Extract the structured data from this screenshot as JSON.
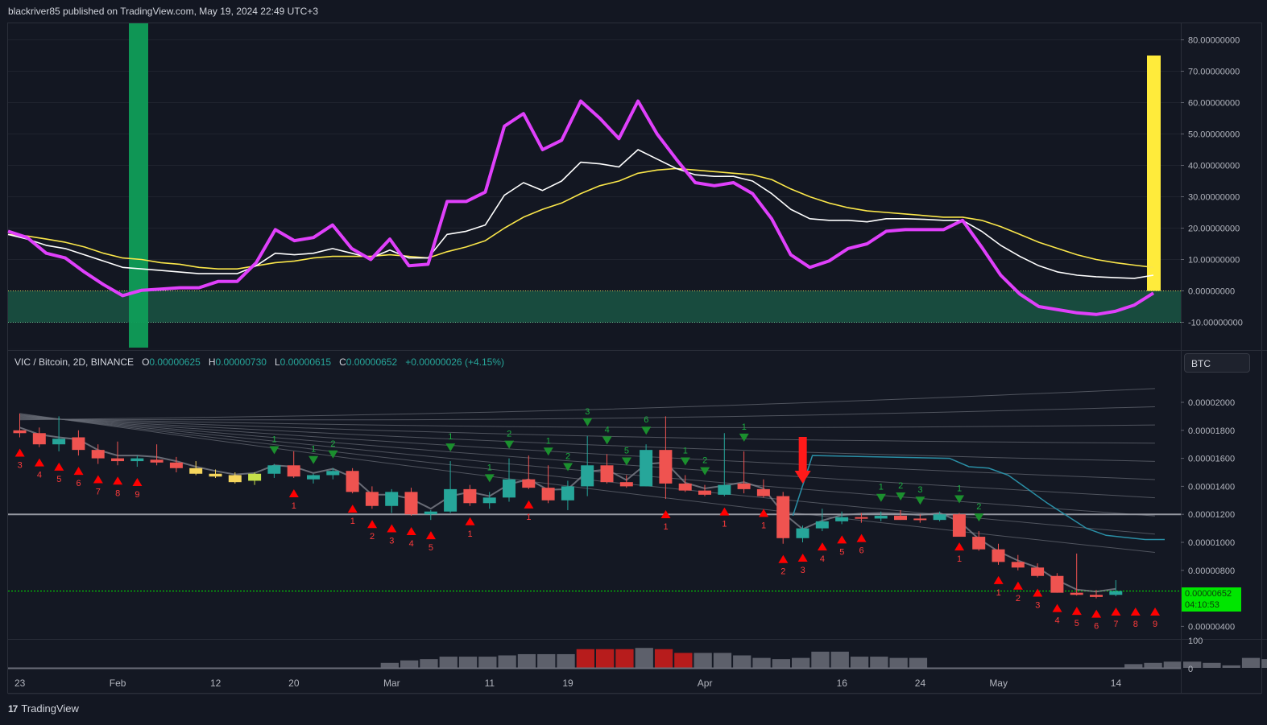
{
  "header": {
    "published": "blackriver85 published on TradingView.com, May 19, 2024 22:49 UTC+3"
  },
  "footer": {
    "brand": "TradingView",
    "brand_icon": "tradingview-logo-icon"
  },
  "colors": {
    "background": "#131722",
    "oscillator": "#e040fb",
    "signal_white": "#ffffff",
    "signal_yellow": "#fbe74a",
    "zone_green": "#1b5e48",
    "up": "#26a69a",
    "down": "#ef5350",
    "buy_marker": "#0f9d2c",
    "sell_marker": "#ff0000"
  },
  "legend": {
    "symbol": "VIC / Bitcoin, 2D, BINANCE",
    "o_label": "O",
    "o": "0.00000625",
    "h_label": "H",
    "h": "0.00000730",
    "l_label": "L",
    "l": "0.00000615",
    "c_label": "C",
    "c": "0.00000652",
    "change": "+0.00000026 (+4.15%)"
  },
  "scale_button": "BTC",
  "last_price": {
    "value": "0.00000652",
    "countdown": "04:10:53"
  },
  "chart_data": [
    {
      "type": "line",
      "name": "oscillator-pane",
      "ylim": [
        -10,
        85
      ],
      "y_ticks": [
        "80.00000000",
        "70.00000000",
        "60.00000000",
        "50.00000000",
        "40.00000000",
        "30.00000000",
        "20.00000000",
        "10.00000000",
        "0.00000000",
        "-10.00000000"
      ],
      "y_tick_values": [
        80,
        70,
        60,
        50,
        40,
        30,
        20,
        10,
        0,
        -10
      ],
      "zone": [
        -10,
        0
      ],
      "series": [
        {
          "color": "#e040fb",
          "values": [
            19,
            17,
            12,
            10.5,
            6,
            2,
            -1.5,
            0.2,
            0.6,
            1,
            1,
            3,
            3,
            9,
            19.5,
            16,
            17,
            21,
            13.5,
            10,
            16.5,
            8,
            8.5,
            28.5,
            28.5,
            31.5,
            52.5,
            56.5,
            45,
            48,
            60.5,
            55,
            48.5,
            60.5,
            50,
            42,
            34.5,
            33.5,
            34.5,
            31,
            23,
            11.5,
            7.5,
            9.5,
            13.5,
            15,
            19,
            19.5,
            19.5,
            19.5,
            22.5,
            14,
            5,
            -1,
            -5,
            -6,
            -7,
            -7.5,
            -6.5,
            -4.5,
            -0.7
          ]
        },
        {
          "color": "#ffffff",
          "values": [
            18,
            16.5,
            14.5,
            13.5,
            11.5,
            9.5,
            7.5,
            7,
            6.5,
            6,
            5.5,
            5.5,
            5.5,
            8,
            12,
            11.5,
            12,
            13.5,
            12,
            10.5,
            13,
            10.5,
            10.5,
            18,
            19,
            21,
            30.5,
            34.5,
            32,
            35,
            41,
            40.5,
            39.5,
            45,
            42,
            39,
            37,
            36.5,
            36.5,
            35,
            31,
            26,
            23,
            22.5,
            22.5,
            22,
            23,
            23,
            22.8,
            22.5,
            22.5,
            19,
            14.5,
            11,
            8,
            6,
            5,
            4.5,
            4.2,
            4,
            5
          ]
        },
        {
          "color": "#fbe74a",
          "values": [
            18,
            17.5,
            16.5,
            15.5,
            14,
            12,
            10.5,
            10,
            9,
            8.5,
            7.5,
            7,
            7,
            8,
            9,
            9.5,
            10.5,
            11,
            11,
            11,
            11.5,
            11,
            10.5,
            12.5,
            14,
            16,
            20,
            23.5,
            26,
            28,
            31,
            33.5,
            35,
            37.5,
            38.5,
            39,
            38.5,
            38,
            37.5,
            37,
            35.5,
            32.5,
            30,
            28,
            26.5,
            25.5,
            25,
            24.5,
            24,
            23.5,
            23.5,
            22.5,
            20.5,
            18,
            15.5,
            13.5,
            11.5,
            10,
            9,
            8.2,
            7.5
          ]
        }
      ],
      "signal_bars": [
        {
          "color": "#0f9d58",
          "x_index": 6.5,
          "height": "full"
        },
        {
          "color": "#ffeb3b",
          "x_index": 59.5,
          "top": 75
        }
      ]
    },
    {
      "type": "candlestick",
      "name": "price-pane",
      "ylim": [
        3.4e-06,
        2.16e-05
      ],
      "y_ticks": [
        "0.00002000",
        "0.00001800",
        "0.00001600",
        "0.00001400",
        "0.00001200",
        "0.00001000",
        "0.00000800",
        "0.00000400"
      ],
      "y_tick_values": [
        2e-05,
        1.8e-05,
        1.6e-05,
        1.4e-05,
        1.2e-05,
        1e-05,
        8e-06,
        4e-06
      ],
      "x_ticks": [
        {
          "label": "23",
          "i": 0.5
        },
        {
          "label": "Feb",
          "i": 5.5
        },
        {
          "label": "12",
          "i": 10.5
        },
        {
          "label": "20",
          "i": 14.5
        },
        {
          "label": "Mar",
          "i": 19.5
        },
        {
          "label": "11",
          "i": 24.5
        },
        {
          "label": "19",
          "i": 28.5
        },
        {
          "label": "Apr",
          "i": 35.5
        },
        {
          "label": "16",
          "i": 42.5
        },
        {
          "label": "24",
          "i": 46.5
        },
        {
          "label": "May",
          "i": 50.5
        },
        {
          "label": "14",
          "i": 56.5
        }
      ],
      "ohlc": [
        [
          18.0,
          19.2,
          17.5,
          17.8
        ],
        [
          17.8,
          18.2,
          16.8,
          17.0
        ],
        [
          17.0,
          19.0,
          16.5,
          17.4
        ],
        [
          17.5,
          18.0,
          16.2,
          16.6
        ],
        [
          16.6,
          17.0,
          15.6,
          16.0
        ],
        [
          16.0,
          17.2,
          15.5,
          15.8
        ],
        [
          15.8,
          16.2,
          15.4,
          16.0
        ],
        [
          15.9,
          17.0,
          15.5,
          15.7
        ],
        [
          15.7,
          16.1,
          15.0,
          15.3
        ],
        [
          15.3,
          15.8,
          14.8,
          14.9
        ],
        [
          14.9,
          15.2,
          14.6,
          14.7
        ],
        [
          14.8,
          15.0,
          14.2,
          14.3
        ],
        [
          14.4,
          15.0,
          14.1,
          14.9
        ],
        [
          14.9,
          15.6,
          14.6,
          15.5
        ],
        [
          15.5,
          16.5,
          14.6,
          14.7
        ],
        [
          14.5,
          14.9,
          14.2,
          14.8
        ],
        [
          14.8,
          15.3,
          14.5,
          15.1
        ],
        [
          15.1,
          15.3,
          13.5,
          13.6
        ],
        [
          13.6,
          14.0,
          12.4,
          12.6
        ],
        [
          12.6,
          13.8,
          12.1,
          13.6
        ],
        [
          13.6,
          13.9,
          11.9,
          12.0
        ],
        [
          12.0,
          12.3,
          11.6,
          12.2
        ],
        [
          12.2,
          15.8,
          12.1,
          13.8
        ],
        [
          13.8,
          14.1,
          12.6,
          12.8
        ],
        [
          12.8,
          13.6,
          12.4,
          13.2
        ],
        [
          13.2,
          16.0,
          12.9,
          14.5
        ],
        [
          14.5,
          16.2,
          13.8,
          13.9
        ],
        [
          13.9,
          15.5,
          12.8,
          13.0
        ],
        [
          13.0,
          14.4,
          12.3,
          14.0
        ],
        [
          14.0,
          17.6,
          13.3,
          15.5
        ],
        [
          15.5,
          16.3,
          14.2,
          14.3
        ],
        [
          14.3,
          14.8,
          13.9,
          14.0
        ],
        [
          14.0,
          17.0,
          14.0,
          16.6
        ],
        [
          16.6,
          19.0,
          13.1,
          14.2
        ],
        [
          14.2,
          14.8,
          13.6,
          13.7
        ],
        [
          13.7,
          14.1,
          13.3,
          13.4
        ],
        [
          13.4,
          17.8,
          13.3,
          14.1
        ],
        [
          14.2,
          16.5,
          13.5,
          13.8
        ],
        [
          13.8,
          14.5,
          13.2,
          13.3
        ],
        [
          13.3,
          13.6,
          9.9,
          10.3
        ],
        [
          10.3,
          11.2,
          10.0,
          11.0
        ],
        [
          11.0,
          12.4,
          10.8,
          11.5
        ],
        [
          11.5,
          12.2,
          11.3,
          11.8
        ],
        [
          11.8,
          12.1,
          11.4,
          11.7
        ],
        [
          11.7,
          12.2,
          11.5,
          11.9
        ],
        [
          11.9,
          12.3,
          11.6,
          11.6
        ],
        [
          11.7,
          12.0,
          11.4,
          11.6
        ],
        [
          11.6,
          12.2,
          11.5,
          12.0
        ],
        [
          12.0,
          12.1,
          10.8,
          10.4
        ],
        [
          10.4,
          10.8,
          9.4,
          9.5
        ],
        [
          9.5,
          9.9,
          8.4,
          8.6
        ],
        [
          8.6,
          9.1,
          8.0,
          8.2
        ],
        [
          8.2,
          8.5,
          7.5,
          7.6
        ],
        [
          7.6,
          7.8,
          6.4,
          6.4
        ],
        [
          6.4,
          9.2,
          6.2,
          6.25
        ],
        [
          6.25,
          6.6,
          6.0,
          6.1
        ],
        [
          6.25,
          7.3,
          6.15,
          6.52
        ]
      ],
      "ohlc_unit": "0.000001",
      "volume_ticks": [
        "100",
        "0"
      ],
      "volume": [
        0,
        0,
        0,
        0,
        0,
        0,
        0,
        0,
        0,
        0,
        0,
        0,
        0,
        0,
        0,
        0,
        0,
        0,
        0,
        20,
        30,
        35,
        45,
        45,
        45,
        50,
        55,
        55,
        55,
        75,
        75,
        75,
        80,
        75,
        60,
        60,
        60,
        50,
        40,
        35,
        40,
        65,
        65,
        45,
        45,
        40,
        40,
        0,
        0,
        0,
        0,
        0,
        0,
        0,
        0,
        0,
        0,
        15,
        20,
        25,
        25,
        20,
        10,
        40,
        35,
        45
      ],
      "volume_red": [
        29,
        30,
        31,
        33,
        34
      ],
      "sequential_sell": [
        {
          "i": 0.5,
          "n": "3"
        },
        {
          "i": 1.5,
          "n": "4"
        },
        {
          "i": 2.5,
          "n": "5"
        },
        {
          "i": 3.5,
          "n": "6"
        },
        {
          "i": 4.5,
          "n": "7"
        },
        {
          "i": 5.5,
          "n": "8"
        },
        {
          "i": 6.5,
          "n": "9"
        },
        {
          "i": 14.5,
          "n": "1"
        },
        {
          "i": 17.5,
          "n": "1"
        },
        {
          "i": 18.5,
          "n": "2"
        },
        {
          "i": 19.5,
          "n": "3"
        },
        {
          "i": 20.5,
          "n": "4"
        },
        {
          "i": 21.5,
          "n": "5"
        },
        {
          "i": 23.5,
          "n": "1"
        },
        {
          "i": 26.5,
          "n": "1"
        },
        {
          "i": 33.5,
          "n": "1"
        },
        {
          "i": 36.5,
          "n": "1"
        },
        {
          "i": 38.5,
          "n": "1"
        },
        {
          "i": 39.5,
          "n": "2"
        },
        {
          "i": 40.5,
          "n": "3"
        },
        {
          "i": 41.5,
          "n": "4"
        },
        {
          "i": 42.5,
          "n": "5"
        },
        {
          "i": 43.5,
          "n": "6"
        },
        {
          "i": 48.5,
          "n": "1"
        },
        {
          "i": 50.5,
          "n": "1"
        },
        {
          "i": 51.5,
          "n": "2"
        },
        {
          "i": 52.5,
          "n": "3"
        },
        {
          "i": 53.5,
          "n": "4"
        },
        {
          "i": 54.5,
          "n": "5"
        },
        {
          "i": 55.5,
          "n": "6"
        },
        {
          "i": 56.5,
          "n": "7"
        },
        {
          "i": 57.5,
          "n": "8"
        },
        {
          "i": 58.5,
          "n": "9"
        }
      ],
      "sequential_buy": [
        {
          "i": 13.5,
          "n": "1"
        },
        {
          "i": 15.5,
          "n": "1"
        },
        {
          "i": 16.5,
          "n": "2"
        },
        {
          "i": 22.5,
          "n": "1"
        },
        {
          "i": 24.5,
          "n": "1"
        },
        {
          "i": 25.5,
          "n": "2"
        },
        {
          "i": 27.5,
          "n": "1"
        },
        {
          "i": 28.5,
          "n": "2"
        },
        {
          "i": 29.5,
          "n": "3"
        },
        {
          "i": 30.5,
          "n": "4"
        },
        {
          "i": 31.5,
          "n": "5"
        },
        {
          "i": 32.5,
          "n": "6"
        },
        {
          "i": 34.5,
          "n": "1"
        },
        {
          "i": 35.5,
          "n": "2"
        },
        {
          "i": 37.5,
          "n": "1"
        },
        {
          "i": 44.5,
          "n": "1"
        },
        {
          "i": 45.5,
          "n": "2"
        },
        {
          "i": 46.5,
          "n": "3"
        },
        {
          "i": 48.5,
          "n": "1"
        },
        {
          "i": 49.5,
          "n": "2"
        }
      ],
      "down_arrow_i": 40.5,
      "horizontal_level": 1.2e-05
    }
  ]
}
